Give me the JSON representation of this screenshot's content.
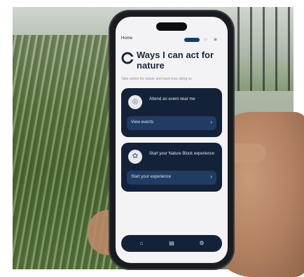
{
  "screen": {
    "home_label": "Home",
    "title": "Ways I can act for nature",
    "subtitle": "Take action for nature and track how doing so",
    "cards": [
      {
        "icon": "calendar-icon",
        "text": "Attend an event near me",
        "button_label": "View events",
        "button_icon": "chevron-right-icon"
      },
      {
        "icon": "leaf-icon",
        "text": "Start your Nature Block experience",
        "button_label": "Start your experience",
        "button_icon": "chevron-right-icon"
      }
    ],
    "tabbar": [
      "home-icon",
      "list-icon",
      "settings-icon"
    ]
  }
}
